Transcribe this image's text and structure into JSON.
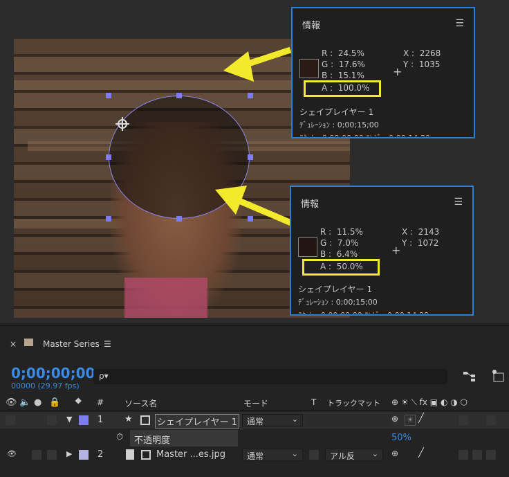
{
  "info_top": {
    "title": "情報",
    "menu_icon": "☰",
    "r": "R :  24.5%",
    "g": "G :  17.6%",
    "b": "B :  15.1%",
    "a": "A :  100.0%",
    "x": "X :  2268",
    "y": "Y :  1035",
    "layer": "シェイプレイヤー 1",
    "duration": "ﾃﾞｭﾚｰｼｮﾝ : 0;00;15;00"
  },
  "info_bottom": {
    "title": "情報",
    "menu_icon": "☰",
    "r": "R :  11.5%",
    "g": "G :  7.0%",
    "b": "B :  6.4%",
    "a": "A :  50.0%",
    "x": "X :  2143",
    "y": "Y :  1072",
    "layer": "シェイプレイヤー 1",
    "duration": "ﾃﾞｭﾚｰｼｮﾝ : 0;00;15;00"
  },
  "timeline": {
    "close": "×",
    "comp_name": "Master Series",
    "menu_icon": "☰",
    "timecode": "0;00;00;00",
    "fps": "00000 (29.97 fps)",
    "search_icon": "ρ▾",
    "columns": {
      "num": "#",
      "source": "ソース名",
      "mode": "モード",
      "t": "T",
      "track_matte": "トラックマット",
      "switches": "⊕ ☀ ⟍ fx ▣ ◐ ◑ ⬡"
    },
    "layers": [
      {
        "index": "1",
        "name": "シェイプレイヤー 1",
        "mode": "通常",
        "star": "★",
        "twirl": "▼"
      },
      {
        "index": "2",
        "name": "Master ...es.jpg",
        "mode": "通常",
        "matte": "アル反",
        "twirl": "▶"
      }
    ],
    "property": {
      "name": "不透明度",
      "value": "50%"
    }
  },
  "colors": {
    "accent_blue": "#2b7fd4",
    "highlight_yellow": "#f2ea2a",
    "timecode_blue": "#3a8be6",
    "label_violet": "#7d7df0"
  }
}
